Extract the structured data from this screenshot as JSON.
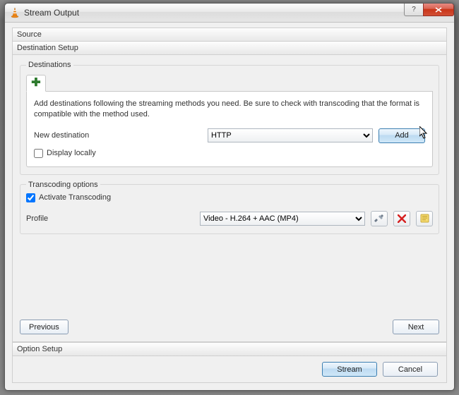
{
  "window": {
    "title": "Stream Output",
    "help_label": "?",
    "close_label": "✕"
  },
  "sections": {
    "source": "Source",
    "destination_setup": "Destination Setup",
    "option_setup": "Option Setup"
  },
  "destinations": {
    "legend": "Destinations",
    "add_tab_glyph": "✚",
    "help_text": "Add destinations following the streaming methods you need. Be sure to check with transcoding that the format is compatible with the method used.",
    "new_destination_label": "New destination",
    "protocol_selected": "HTTP",
    "add_button": "Add",
    "display_locally_label": "Display locally",
    "display_locally_checked": false
  },
  "transcoding": {
    "legend": "Transcoding options",
    "activate_label": "Activate Transcoding",
    "activate_checked": true,
    "profile_label": "Profile",
    "profile_selected": "Video - H.264 + AAC (MP4)"
  },
  "icons": {
    "tools": "tools-icon",
    "delete": "delete-icon",
    "save": "save-profile-icon"
  },
  "nav": {
    "previous": "Previous",
    "next": "Next"
  },
  "footer": {
    "stream": "Stream",
    "cancel": "Cancel"
  }
}
